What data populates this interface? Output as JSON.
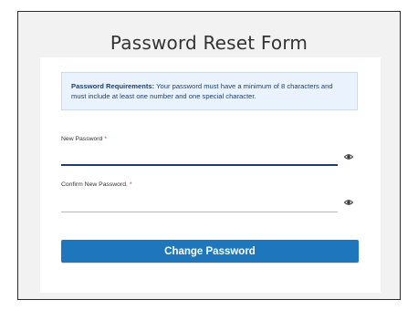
{
  "form": {
    "title": "Password Reset Form",
    "notice": {
      "heading": "Password Requirements:",
      "text": "Your password must have a minimum of 8 characters and must include at least one number and one special character."
    },
    "fields": [
      {
        "label": "New Password",
        "required_marker": "*",
        "value": "",
        "icon": "eye-icon",
        "state": "focused"
      },
      {
        "label": "Confirm New Password.",
        "required_marker": "*",
        "value": "",
        "icon": "eye-icon",
        "state": "default"
      }
    ],
    "submit_label": "Change Password"
  },
  "colors": {
    "accent": "#1e77bd",
    "required": "#d93025",
    "notice_bg": "#eaf3fd",
    "notice_text": "#1e3e72",
    "focused_underline": "#1f3d66"
  }
}
